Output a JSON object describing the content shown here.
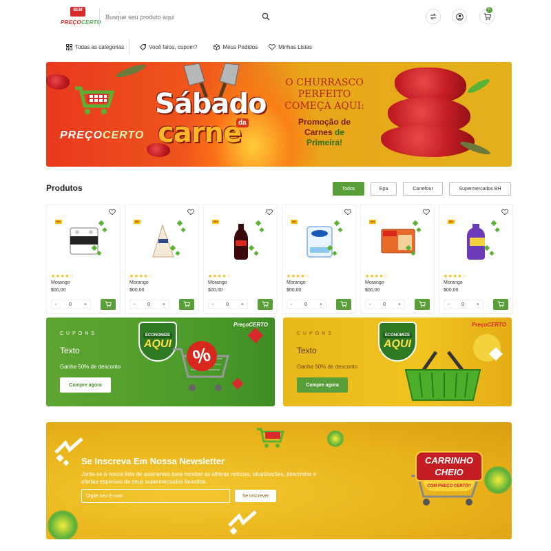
{
  "header": {
    "logo_badge": "BEM",
    "logo_text_a": "PREÇO",
    "logo_text_b": "CERTO",
    "search_placeholder": "Busque seu produto aqui",
    "cart_count": "0"
  },
  "nav": {
    "items": [
      {
        "label": "Todas as categorias",
        "icon": "grid-icon"
      },
      {
        "label": "Você falou, cupom?",
        "icon": "tag-icon"
      },
      {
        "label": "Meus Pedidos",
        "icon": "box-icon"
      },
      {
        "label": "Minhas Listas",
        "icon": "heart-icon"
      }
    ]
  },
  "hero": {
    "brand_a": "PREÇO",
    "brand_b": "CERTO",
    "headline_1": "Sábado",
    "headline_da": "da",
    "headline_2": "carne",
    "slogan": "O CHURRASCO PERFEITO COMEÇA AQUI:",
    "promo_1": "Promoção de",
    "promo_2": "Carnes",
    "promo_3": "de",
    "promo_4": "Primeira!"
  },
  "products_section": {
    "title": "Produtos",
    "filters": [
      "Todos",
      "Epa",
      "Carrefour",
      "Supermercados BH"
    ],
    "active_filter": "Todos",
    "items": [
      {
        "name": "Morango",
        "price": "$00,00",
        "rating": 4,
        "qty": "0",
        "badge": "BH",
        "image_label": "Personal"
      },
      {
        "name": "Morango",
        "price": "$00,00",
        "rating": 4,
        "qty": "0",
        "badge": "BH",
        "image_label": ""
      },
      {
        "name": "Morango",
        "price": "$00,00",
        "rating": 4,
        "qty": "0",
        "badge": "BH",
        "image_label": ""
      },
      {
        "name": "Morango",
        "price": "$00,00",
        "rating": 4,
        "qty": "0",
        "badge": "BH",
        "image_label": "Cristal"
      },
      {
        "name": "Morango",
        "price": "$00,00",
        "rating": 4,
        "qty": "0",
        "badge": "BH",
        "image_label": "Vilma"
      },
      {
        "name": "Morango",
        "price": "$00,00",
        "rating": 4,
        "qty": "0",
        "badge": "BH",
        "image_label": "Veja"
      }
    ],
    "stars": "★★★★☆",
    "minus": "-",
    "plus": "+"
  },
  "coupons": [
    {
      "kicker": "CUPONS",
      "title": "Texto",
      "desc": "Ganhe 50% de desconto",
      "button": "Compre agora",
      "shield_top": "ECONOMIZE",
      "shield_main": "AQUI",
      "brand": "PreçoCERTO",
      "percent": "%"
    },
    {
      "kicker": "CUPONS",
      "title": "Texto",
      "desc": "Ganhe 50% de desconto",
      "button": "Compre agora",
      "shield_top": "ECONOMIZE",
      "shield_main": "AQUI",
      "brand": "PreçoCERTO",
      "percent": "%"
    }
  ],
  "newsletter": {
    "title": "Se Inscreva Em Nossa Newsletter",
    "desc": "Junte-se à nossa lista de assinantes para receber as últimas notícias, atualizações, descontos e ofertas especiais de seus supermercados favoritos.",
    "email_placeholder": "Digite seu E-mail",
    "button": "Se inscrever",
    "badge_line1": "CARRINHO",
    "badge_line2": "CHEIO",
    "badge_sub": "COM PREÇO CERTO!!"
  },
  "colors": {
    "accent_green": "#5a9e3a",
    "brand_red": "#d82a2a",
    "banner_yellow": "#e8b21a"
  }
}
